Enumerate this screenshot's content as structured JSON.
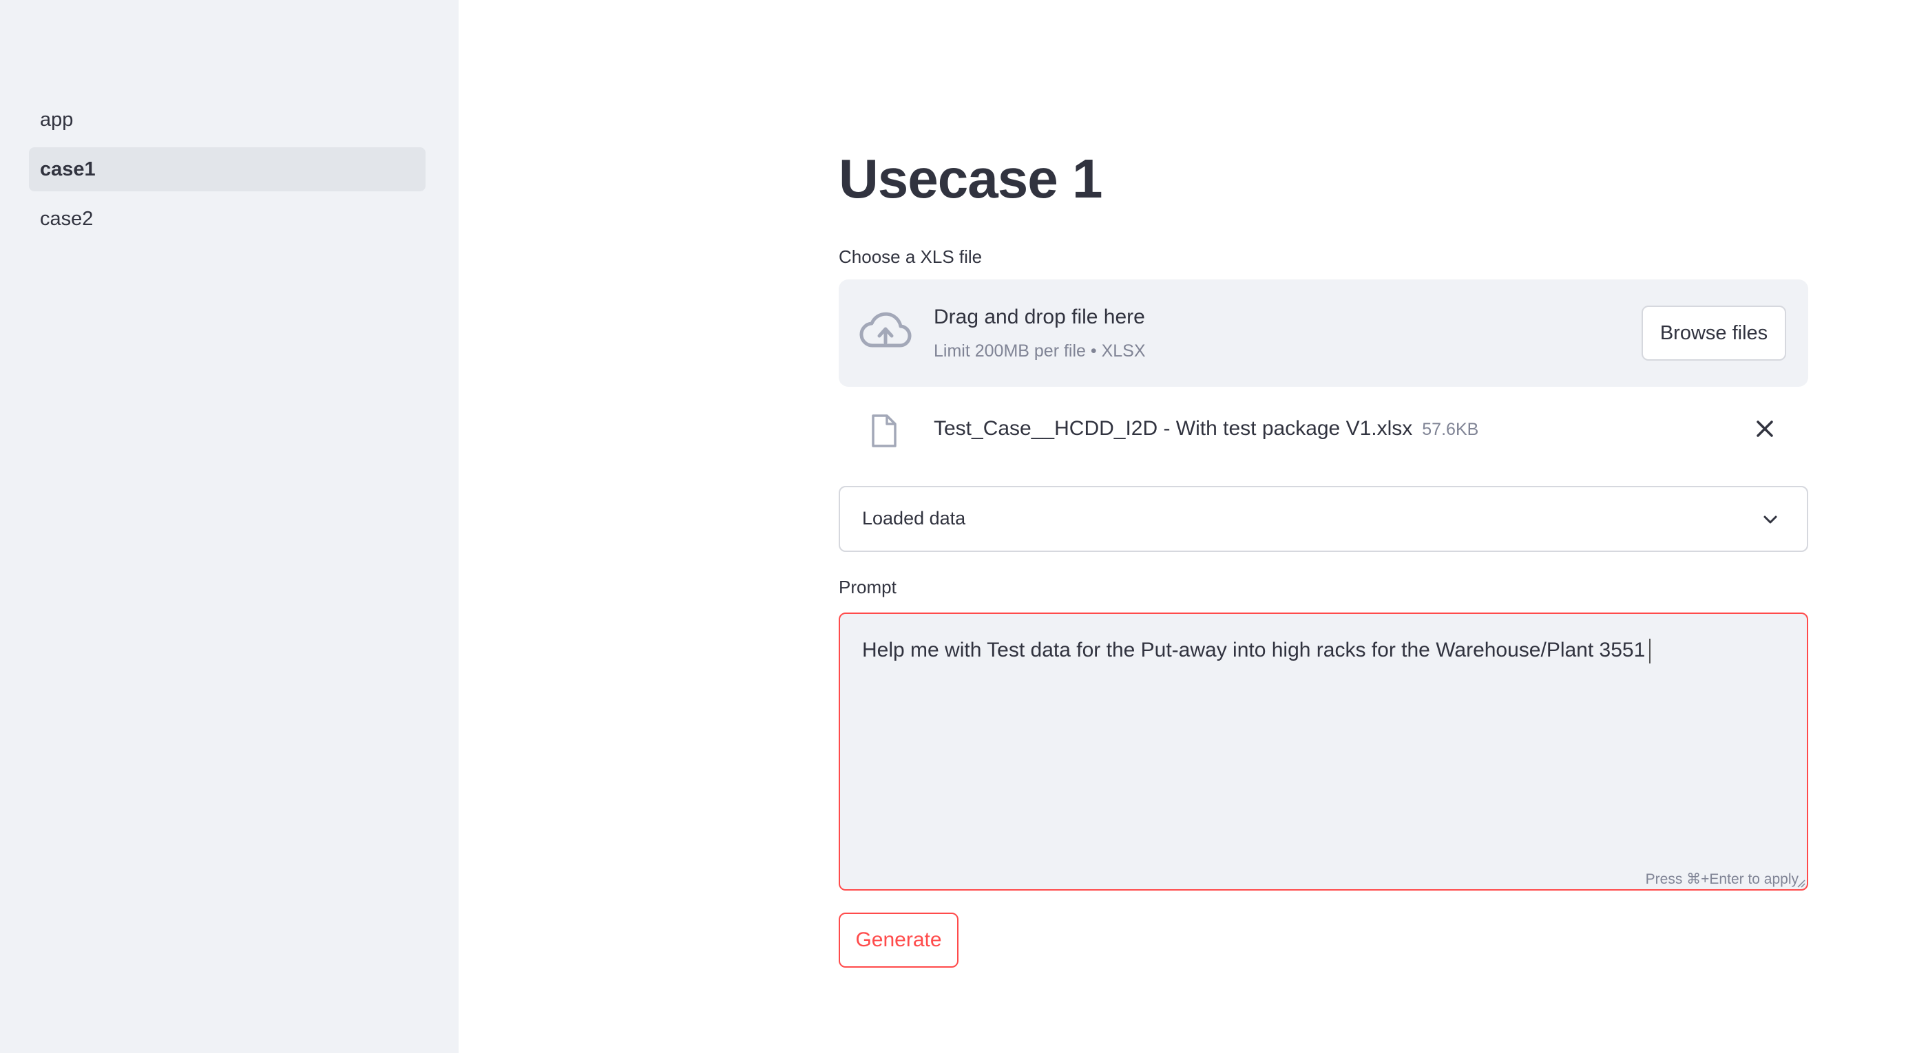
{
  "sidebar": {
    "items": [
      {
        "label": "app",
        "active": false
      },
      {
        "label": "case1",
        "active": true
      },
      {
        "label": "case2",
        "active": false
      }
    ]
  },
  "main": {
    "title": "Usecase 1",
    "uploader": {
      "label": "Choose a XLS file",
      "drop_title": "Drag and drop file here",
      "drop_subtitle": "Limit 200MB per file • XLSX",
      "browse_label": "Browse files",
      "icon": "cloud-upload-icon"
    },
    "uploaded_file": {
      "name": "Test_Case__HCDD_I2D - With test package V1.xlsx",
      "size": "57.6KB",
      "icon": "file-icon"
    },
    "expander": {
      "label": "Loaded data",
      "expanded": false
    },
    "prompt": {
      "label": "Prompt",
      "value": "Help me with Test data for the Put-away into high racks for the Warehouse/Plant 3551",
      "hint": "Press ⌘+Enter to apply"
    },
    "generate_label": "Generate"
  },
  "colors": {
    "accent": "#ff4b4b",
    "sidebar_bg": "#f0f2f6",
    "text": "#31333f",
    "muted": "#808495"
  }
}
